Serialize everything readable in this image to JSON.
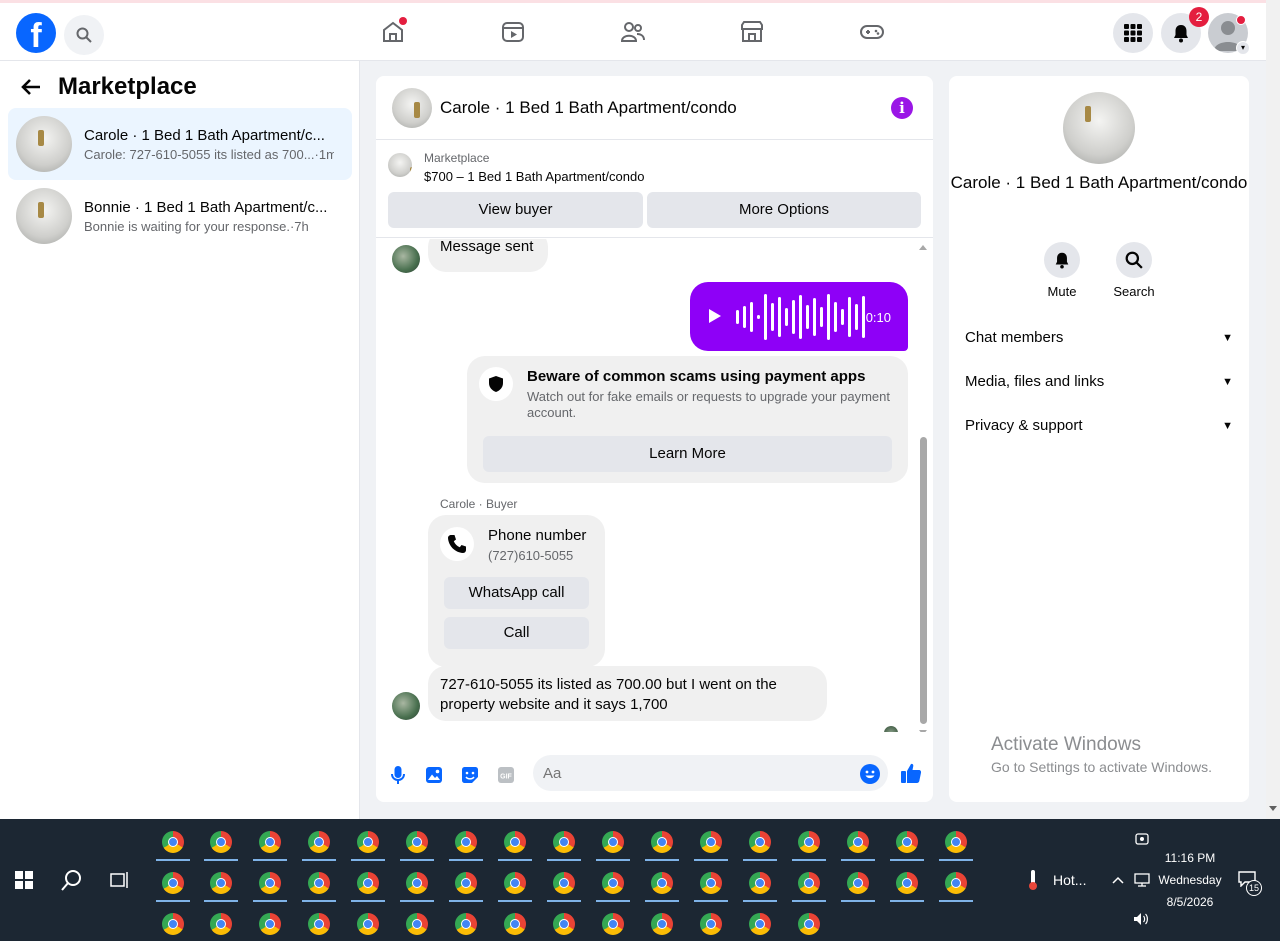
{
  "topbar": {
    "logo": "f",
    "notif_count": "2"
  },
  "sidebar": {
    "title": "Marketplace",
    "conversations": [
      {
        "title": "Carole · 1 Bed 1 Bath Apartment/c...",
        "preview": "Carole: 727-610-5055 its listed as 700...·1m"
      },
      {
        "title": "Bonnie · 1 Bed 1 Bath Apartment/c...",
        "preview": "Bonnie is waiting for your response.·7h"
      }
    ]
  },
  "chat": {
    "title": "Carole · 1 Bed 1 Bath Apartment/condo",
    "marketplace_label": "Marketplace",
    "listing": "$700 – 1 Bed 1 Bath Apartment/condo",
    "view_buyer": "View buyer",
    "more_options": "More Options",
    "msg_sent": "Message sent",
    "voice_duration": "0:10",
    "voice_wave": [
      14,
      22,
      30,
      4,
      46,
      28,
      40,
      18,
      34,
      44,
      24,
      38,
      20,
      46,
      30,
      16,
      40,
      26,
      42
    ],
    "scam_title": "Beware of common scams using payment apps",
    "scam_desc": "Watch out for fake emails or requests to upgrade your payment account.",
    "learn_more": "Learn More",
    "sender_label": "Carole · Buyer",
    "phone_title": "Phone number",
    "phone_value": "(727)610-5055",
    "whatsapp_call": "WhatsApp call",
    "call": "Call",
    "last_msg": "727-610-5055  its listed  as 700.00 but I went on the property website and it says 1,700",
    "input_placeholder": "Aa"
  },
  "details": {
    "title": "Carole · 1 Bed 1 Bath Apartment/condo",
    "mute": "Mute",
    "search": "Search",
    "sections": [
      "Chat members",
      "Media, files and links",
      "Privacy & support"
    ]
  },
  "watermark": {
    "line1": "Activate Windows",
    "line2": "Go to Settings to activate Windows."
  },
  "taskbar": {
    "weather": "Hot...",
    "time": "11:16 PM",
    "day": "Wednesday",
    "date": "8/5/2026",
    "notif_count": "15"
  },
  "colors": {
    "brand": "#0866ff",
    "voice": "#8e00f7",
    "info": "#9a16e6",
    "badge": "#e41e3f"
  }
}
